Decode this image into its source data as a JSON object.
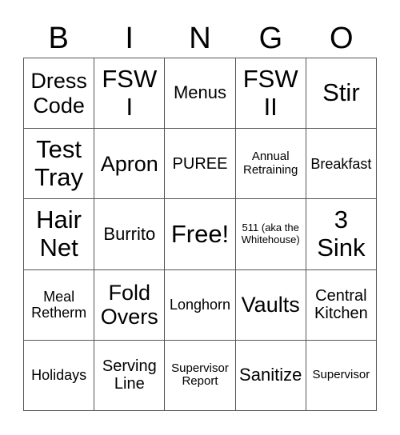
{
  "header": {
    "letters": [
      "B",
      "I",
      "N",
      "G",
      "O"
    ]
  },
  "cells": [
    [
      "Dress\nCode",
      "FSW\nI",
      "Menus",
      "FSW\nII",
      "Stir"
    ],
    [
      "Test\nTray",
      "Apron",
      "PUREE",
      "Annual\nRetraining",
      "Breakfast"
    ],
    [
      "Hair\nNet",
      "Burrito",
      "Free!",
      "511 (aka the\nWhitehouse)",
      "3\nSink"
    ],
    [
      "Meal\nRetherm",
      "Fold\nOvers",
      "Longhorn",
      "Vaults",
      "Central\nKitchen"
    ],
    [
      "Holidays",
      "Serving\nLine",
      "Supervisor\nReport",
      "Sanitize",
      "Supervisor"
    ]
  ]
}
